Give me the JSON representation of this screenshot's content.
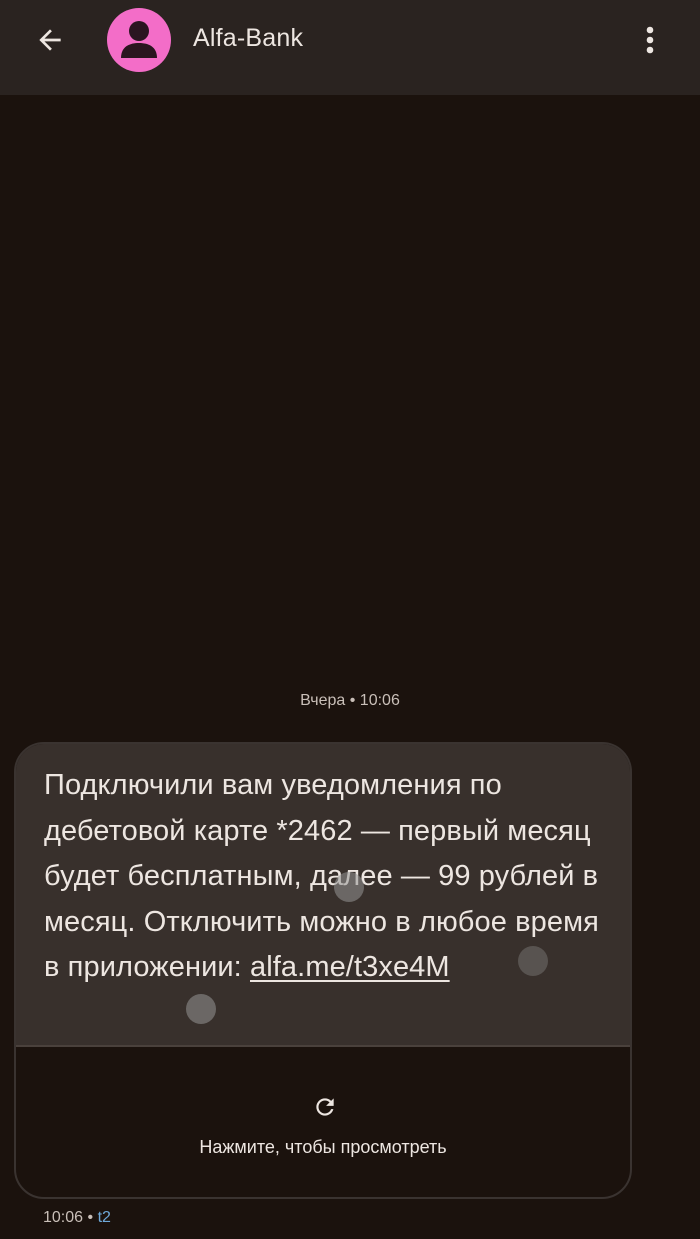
{
  "header": {
    "contact_name": "Alfa-Bank",
    "back_icon": "arrow-back-icon",
    "menu_icon": "more-vert-icon",
    "avatar_color": "#f36dc8"
  },
  "conversation": {
    "date_separator": "Вчера • 10:06",
    "message": {
      "text": "Подключили вам уведомления по дебетовой карте *2462 — первый месяц будет бесплатным, далее — 99 рублей в месяц. Отключить можно в любое время в приложении: ",
      "link_text": "alfa.me/t3xe4M",
      "preview_label": "Нажмите, чтобы просмотреть",
      "preview_icon": "refresh-icon",
      "time": "10:06",
      "separator": "•",
      "sim": "t2"
    }
  }
}
